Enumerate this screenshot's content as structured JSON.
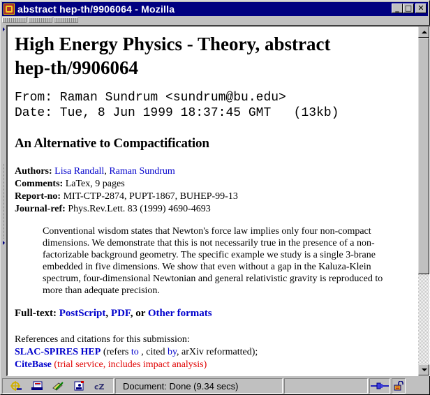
{
  "window": {
    "title": "abstract hep-th/9906064 - Mozilla",
    "controls": {
      "minimize": "_",
      "maximize": "□",
      "close": "✕"
    }
  },
  "page": {
    "heading_line1": "High Energy Physics - Theory, abstract",
    "heading_line2": "hep-th/9906064",
    "from_line": "From: Raman Sundrum <sundrum@bu.edu>",
    "date_line": "Date: Tue, 8 Jun 1999 18:37:45 GMT   (13kb)",
    "paper_title": "An Alternative to Compactification",
    "authors_label": "Authors:",
    "authors": [
      "Lisa Randall",
      "Raman Sundrum"
    ],
    "comments_label": "Comments:",
    "comments": "LaTex, 9 pages",
    "report_label": "Report-no:",
    "report": "MIT-CTP-2874, PUPT-1867, BUHEP-99-13",
    "journal_label": "Journal-ref:",
    "journal": "Phys.Rev.Lett. 83 (1999) 4690-4693",
    "abstract": "Conventional wisdom states that Newton's force law implies only four non-compact dimensions. We demonstrate that this is not necessarily true in the presence of a non-factorizable background geometry.  The specific example we study is a single 3-brane embedded in five dimensions. We show that even without a gap in the Kaluza-Klein spectrum, four-dimensional Newtonian and general relativistic gravity is reproduced to more than adequate precision.",
    "fulltext": {
      "label": "Full-text:",
      "postscript": "PostScript",
      "pdf": "PDF",
      "or": "or",
      "other": "Other formats"
    },
    "refs": {
      "intro": "References and citations for this submission:",
      "slac": "SLAC-SPIRES HEP",
      "refers_pre": " (refers ",
      "refers_to": "to",
      "cited_pre": " , cited ",
      "cited_by": "by",
      "arxiv_post": ", arXiv reformatted);",
      "citebase": "CiteBase",
      "citebase_note": " (trial service, includes impact analysis)"
    }
  },
  "statusbar": {
    "icons": [
      "navigator-icon",
      "mail-icon",
      "composer-icon",
      "address-book-icon",
      "irc-chat-icon"
    ],
    "status_text": "Document: Done (9.34 secs)"
  },
  "colors": {
    "titlebar": "#000080",
    "link": "#0000cc",
    "note_red": "#e00000",
    "chrome": "#c0c0c0"
  }
}
